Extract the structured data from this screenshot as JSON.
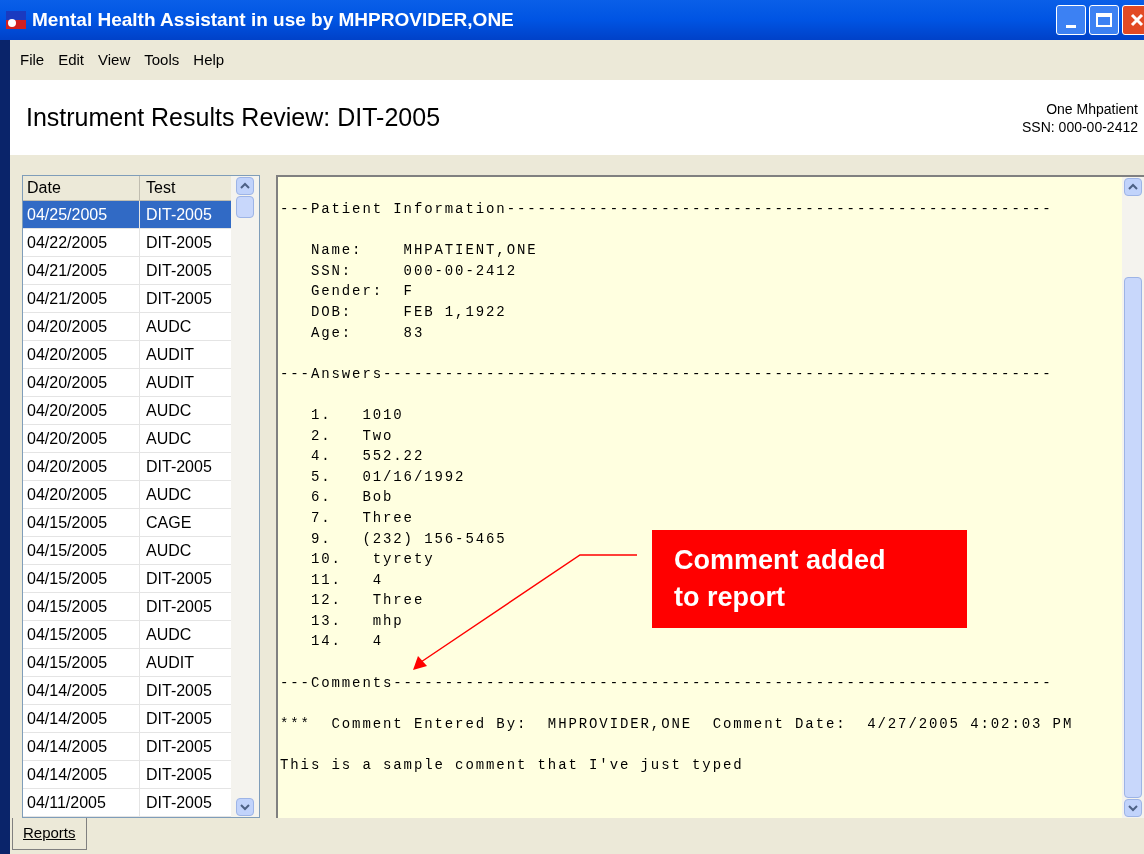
{
  "window": {
    "title": "Mental Health Assistant in use by MHPROVIDER,ONE"
  },
  "menu": [
    "File",
    "Edit",
    "View",
    "Tools",
    "Help"
  ],
  "header": {
    "title": "Instrument Results Review: DIT-2005",
    "patient_name": "One Mhpatient",
    "patient_ssn": "SSN: 000-00-2412"
  },
  "table": {
    "columns": [
      "Date",
      "Test"
    ],
    "rows": [
      {
        "date": "04/25/2005",
        "test": "DIT-2005",
        "selected": true
      },
      {
        "date": "04/22/2005",
        "test": "DIT-2005",
        "selected": false
      },
      {
        "date": "04/21/2005",
        "test": "DIT-2005",
        "selected": false
      },
      {
        "date": "04/21/2005",
        "test": "DIT-2005",
        "selected": false
      },
      {
        "date": "04/20/2005",
        "test": "AUDC",
        "selected": false
      },
      {
        "date": "04/20/2005",
        "test": "AUDIT",
        "selected": false
      },
      {
        "date": "04/20/2005",
        "test": "AUDIT",
        "selected": false
      },
      {
        "date": "04/20/2005",
        "test": "AUDC",
        "selected": false
      },
      {
        "date": "04/20/2005",
        "test": "AUDC",
        "selected": false
      },
      {
        "date": "04/20/2005",
        "test": "DIT-2005",
        "selected": false
      },
      {
        "date": "04/20/2005",
        "test": "AUDC",
        "selected": false
      },
      {
        "date": "04/15/2005",
        "test": "CAGE",
        "selected": false
      },
      {
        "date": "04/15/2005",
        "test": "AUDC",
        "selected": false
      },
      {
        "date": "04/15/2005",
        "test": "DIT-2005",
        "selected": false
      },
      {
        "date": "04/15/2005",
        "test": "DIT-2005",
        "selected": false
      },
      {
        "date": "04/15/2005",
        "test": "AUDC",
        "selected": false
      },
      {
        "date": "04/15/2005",
        "test": "AUDIT",
        "selected": false
      },
      {
        "date": "04/14/2005",
        "test": "DIT-2005",
        "selected": false
      },
      {
        "date": "04/14/2005",
        "test": "DIT-2005",
        "selected": false
      },
      {
        "date": "04/14/2005",
        "test": "DIT-2005",
        "selected": false
      },
      {
        "date": "04/14/2005",
        "test": "DIT-2005",
        "selected": false
      },
      {
        "date": "04/11/2005",
        "test": "DIT-2005",
        "selected": false
      }
    ]
  },
  "report": {
    "blocks": [
      [
        "---Patient Information-----------------------------------------------------"
      ],
      [
        "   Name:    MHPATIENT,ONE",
        "   SSN:     000-00-2412",
        "   Gender:  F",
        "   DOB:     FEB 1,1922",
        "   Age:     83"
      ],
      [
        "---Answers-----------------------------------------------------------------"
      ],
      [
        "   1.   1010",
        "   2.   Two",
        "   4.   552.22",
        "   5.   01/16/1992",
        "   6.   Bob",
        "   7.   Three",
        "   9.   (232) 156-5465",
        "   10.   tyrety",
        "   11.   4",
        "   12.   Three",
        "   13.   mhp",
        "   14.   4"
      ],
      [
        "---Comments----------------------------------------------------------------"
      ],
      [
        "***  Comment Entered By:  MHPROVIDER,ONE  Comment Date:  4/27/2005 4:02:03 PM"
      ],
      [
        "This is a sample comment that I've just typed"
      ]
    ]
  },
  "annotation": {
    "text": "Comment added to report"
  },
  "tabs": [
    {
      "label": "Reports",
      "selected": true
    }
  ]
}
